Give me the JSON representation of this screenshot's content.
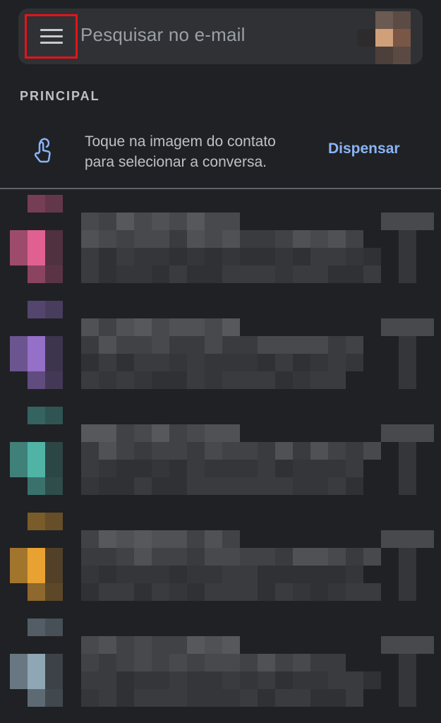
{
  "search": {
    "placeholder": "Pesquisar no e-mail"
  },
  "section": {
    "label": "PRINCIPAL"
  },
  "tip": {
    "line1": "Toque na imagem do contato",
    "line2": "para selecionar a conversa.",
    "dismiss_label": "Dispensar"
  },
  "icons": {
    "menu": "hamburger-menu-icon",
    "touch": "touch-gesture-icon",
    "account": "account-avatar"
  },
  "colors": {
    "background": "#202124",
    "searchbar": "#303134",
    "accent_link": "#8ab4f8",
    "highlight_border": "#e2141a"
  },
  "threads": [
    {
      "avatar_color": "#e06191"
    },
    {
      "avatar_color": "#9470c9"
    },
    {
      "avatar_color": "#4fb3a6"
    },
    {
      "avatar_color": "#e8a232"
    },
    {
      "avatar_color": "#8fa6b4"
    }
  ]
}
